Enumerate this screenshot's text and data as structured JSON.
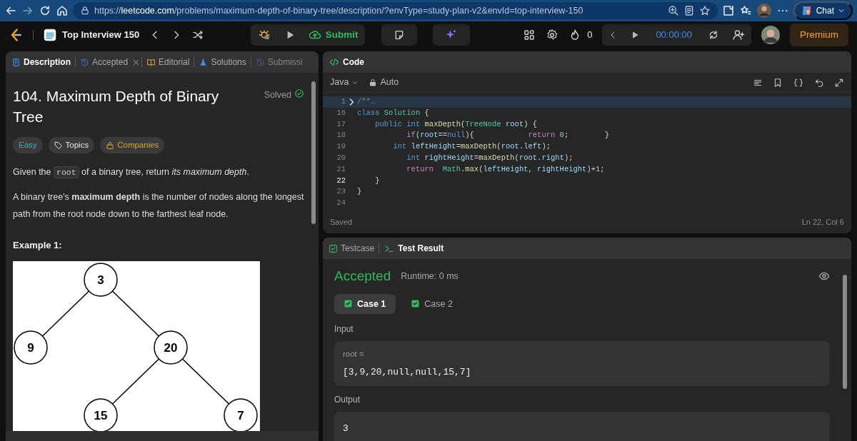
{
  "browser": {
    "url_host": "leetcode.com",
    "url_rest": "/problems/maximum-depth-of-binary-tree/description/?envType=study-plan-v2&envId=top-interview-150",
    "url_scheme": "https://",
    "chat": "Chat"
  },
  "navbar": {
    "study_plan": "Top Interview 150",
    "submit": "Submit",
    "streak": "0",
    "timer": "00:00:00",
    "premium": "Premium"
  },
  "left_tabs": [
    {
      "label": "Description",
      "selected": true,
      "closable": false,
      "faded": false
    },
    {
      "label": "Accepted",
      "selected": false,
      "closable": true,
      "faded": false
    },
    {
      "label": "Editorial",
      "selected": false,
      "closable": false,
      "faded": false
    },
    {
      "label": "Solutions",
      "selected": false,
      "closable": false,
      "faded": false
    },
    {
      "label": "Submissi",
      "selected": false,
      "closable": false,
      "faded": true
    }
  ],
  "problem": {
    "title": "104. Maximum Depth of Binary Tree",
    "status": "Solved",
    "solved": true,
    "tags": [
      {
        "label": "Easy",
        "kind": "difficulty",
        "color": "#2cbbb4"
      },
      {
        "label": "Topics",
        "kind": "topics",
        "color": "#e6e6e6"
      },
      {
        "label": "Companies",
        "kind": "companies",
        "color": "#d9a53a"
      }
    ],
    "paragraphs": [
      [
        {
          "text": "Given the ",
          "kind": "text"
        },
        {
          "text": "root",
          "kind": "code"
        },
        {
          "text": " of a binary tree, return *its maximum depth*.",
          "kind": "text"
        }
      ],
      [
        {
          "text": "A binary tree's **maximum depth** is the number of nodes along the longest path from the root node down to the farthest leaf node.",
          "kind": "text"
        }
      ]
    ],
    "example_title": "Example 1:",
    "example_tree": {
      "value": "3",
      "children": [
        {
          "value": "9"
        },
        {
          "value": "20",
          "children": [
            {
              "value": "15"
            },
            {
              "value": "7"
            }
          ]
        }
      ]
    }
  },
  "code_panel": {
    "tab": "Code",
    "language": "Java",
    "mode": "Auto",
    "status": "Saved",
    "cursor": "Ln 22, Col 6",
    "lines": [
      {
        "number": "1",
        "current": false,
        "highlighted": true,
        "folded": true,
        "tokens": [
          {
            "text": "/**…",
            "kind": "comment"
          }
        ]
      },
      {
        "number": "16",
        "current": false,
        "highlighted": false,
        "folded": false,
        "tokens": [
          {
            "text": "class",
            "kind": "keyword"
          },
          {
            "text": " Solution",
            "kind": "type"
          },
          {
            "text": " {",
            "kind": "plain"
          }
        ]
      },
      {
        "number": "17",
        "current": false,
        "highlighted": false,
        "folded": false,
        "tokens": [
          {
            "text": "    public",
            "kind": "keyword"
          },
          {
            "text": " int",
            "kind": "keyword"
          },
          {
            "text": " maxDepth",
            "kind": "function"
          },
          {
            "text": "(",
            "kind": "plain"
          },
          {
            "text": "TreeNode",
            "kind": "type"
          },
          {
            "text": " root",
            "kind": "variable"
          },
          {
            "text": ") {",
            "kind": "plain"
          }
        ]
      },
      {
        "number": "18",
        "current": false,
        "highlighted": false,
        "folded": false,
        "tokens": [
          {
            "text": "           if",
            "kind": "control"
          },
          {
            "text": "(",
            "kind": "plain"
          },
          {
            "text": "root",
            "kind": "variable"
          },
          {
            "text": "==",
            "kind": "plain"
          },
          {
            "text": "null",
            "kind": "keyword"
          },
          {
            "text": "){",
            "kind": "plain"
          },
          {
            "text": "            return",
            "kind": "control"
          },
          {
            "text": " 0",
            "kind": "number"
          },
          {
            "text": ";        }",
            "kind": "plain"
          }
        ]
      },
      {
        "number": "19",
        "current": false,
        "highlighted": false,
        "folded": false,
        "tokens": [
          {
            "text": "        int",
            "kind": "keyword"
          },
          {
            "text": " leftHeight",
            "kind": "variable"
          },
          {
            "text": "=",
            "kind": "plain"
          },
          {
            "text": "maxDepth",
            "kind": "function"
          },
          {
            "text": "(",
            "kind": "plain"
          },
          {
            "text": "root",
            "kind": "variable"
          },
          {
            "text": ".",
            "kind": "plain"
          },
          {
            "text": "left",
            "kind": "variable"
          },
          {
            "text": ");",
            "kind": "plain"
          }
        ]
      },
      {
        "number": "20",
        "current": false,
        "highlighted": false,
        "folded": false,
        "tokens": [
          {
            "text": "           int",
            "kind": "keyword"
          },
          {
            "text": " rightHeight",
            "kind": "variable"
          },
          {
            "text": "=",
            "kind": "plain"
          },
          {
            "text": "maxDepth",
            "kind": "function"
          },
          {
            "text": "(",
            "kind": "plain"
          },
          {
            "text": "root",
            "kind": "variable"
          },
          {
            "text": ".",
            "kind": "plain"
          },
          {
            "text": "right",
            "kind": "variable"
          },
          {
            "text": ");",
            "kind": "plain"
          }
        ]
      },
      {
        "number": "21",
        "current": false,
        "highlighted": false,
        "folded": false,
        "tokens": [
          {
            "text": "           return",
            "kind": "control"
          },
          {
            "text": "  Math",
            "kind": "type"
          },
          {
            "text": ".",
            "kind": "plain"
          },
          {
            "text": "max",
            "kind": "function"
          },
          {
            "text": "(",
            "kind": "plain"
          },
          {
            "text": "leftHeight",
            "kind": "variable"
          },
          {
            "text": ", ",
            "kind": "plain"
          },
          {
            "text": "rightHeight",
            "kind": "variable"
          },
          {
            "text": ")+",
            "kind": "plain"
          },
          {
            "text": "1",
            "kind": "number"
          },
          {
            "text": ";",
            "kind": "plain"
          }
        ]
      },
      {
        "number": "22",
        "current": true,
        "highlighted": false,
        "folded": false,
        "tokens": [
          {
            "text": "    }",
            "kind": "plain"
          }
        ]
      },
      {
        "number": "23",
        "current": false,
        "highlighted": false,
        "folded": false,
        "tokens": [
          {
            "text": "}",
            "kind": "plain"
          }
        ]
      },
      {
        "number": "24",
        "current": false,
        "highlighted": false,
        "folded": false
      }
    ]
  },
  "result_panel": {
    "tabs": [
      {
        "label": "Testcase",
        "selected": false
      },
      {
        "label": "Test Result",
        "selected": true
      }
    ],
    "verdict": "Accepted",
    "runtime": "Runtime: 0 ms",
    "cases": [
      {
        "label": "Case 1",
        "selected": true,
        "passed": true
      },
      {
        "label": "Case 2",
        "selected": false,
        "passed": true
      }
    ],
    "input_label": "Input",
    "input_name": "root =",
    "input_value": "[3,9,20,null,null,15,7]",
    "output_label": "Output",
    "output_value": "3"
  }
}
